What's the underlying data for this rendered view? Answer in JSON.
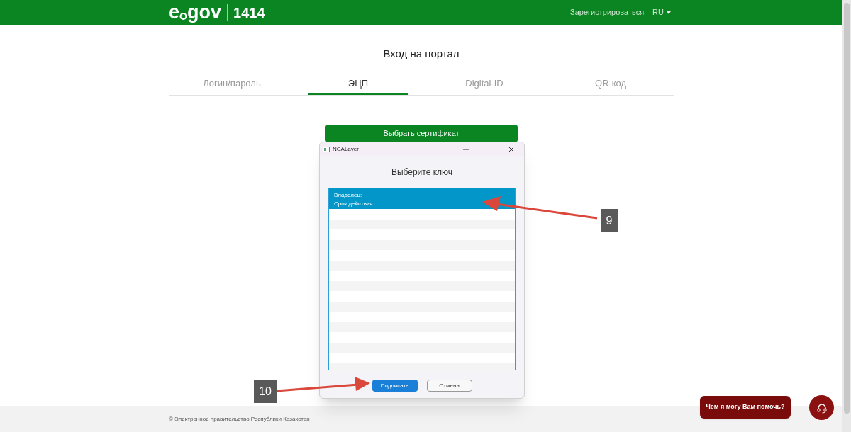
{
  "header": {
    "logo": {
      "left": "e",
      "right": "gov",
      "number": "1414"
    },
    "register_link": "Зарегистрироваться",
    "language": "RU"
  },
  "page_title": "Вход на портал",
  "tabs": [
    {
      "label": "Логин/пароль",
      "selected": false
    },
    {
      "label": "ЭЦП",
      "selected": true
    },
    {
      "label": "Digital-ID",
      "selected": false
    },
    {
      "label": "QR-код",
      "selected": false
    }
  ],
  "select_certificate_button": "Выбрать сертификат",
  "dialog": {
    "title": "NCALayer",
    "heading": "Выберите ключ",
    "keys": [
      {
        "owner_label": "Владелец:",
        "validity_label": "Срок действия:",
        "selected": true
      }
    ],
    "buttons": [
      {
        "label": "Подписать",
        "kind": "primary"
      },
      {
        "label": "Отмена",
        "kind": "secondary"
      }
    ]
  },
  "annotations": [
    {
      "label": "9"
    },
    {
      "label": "10"
    }
  ],
  "footer": "© Электронное правительство Республики Казахстан",
  "chat": {
    "prompt": "Чем я могу Вам помочь?"
  }
}
